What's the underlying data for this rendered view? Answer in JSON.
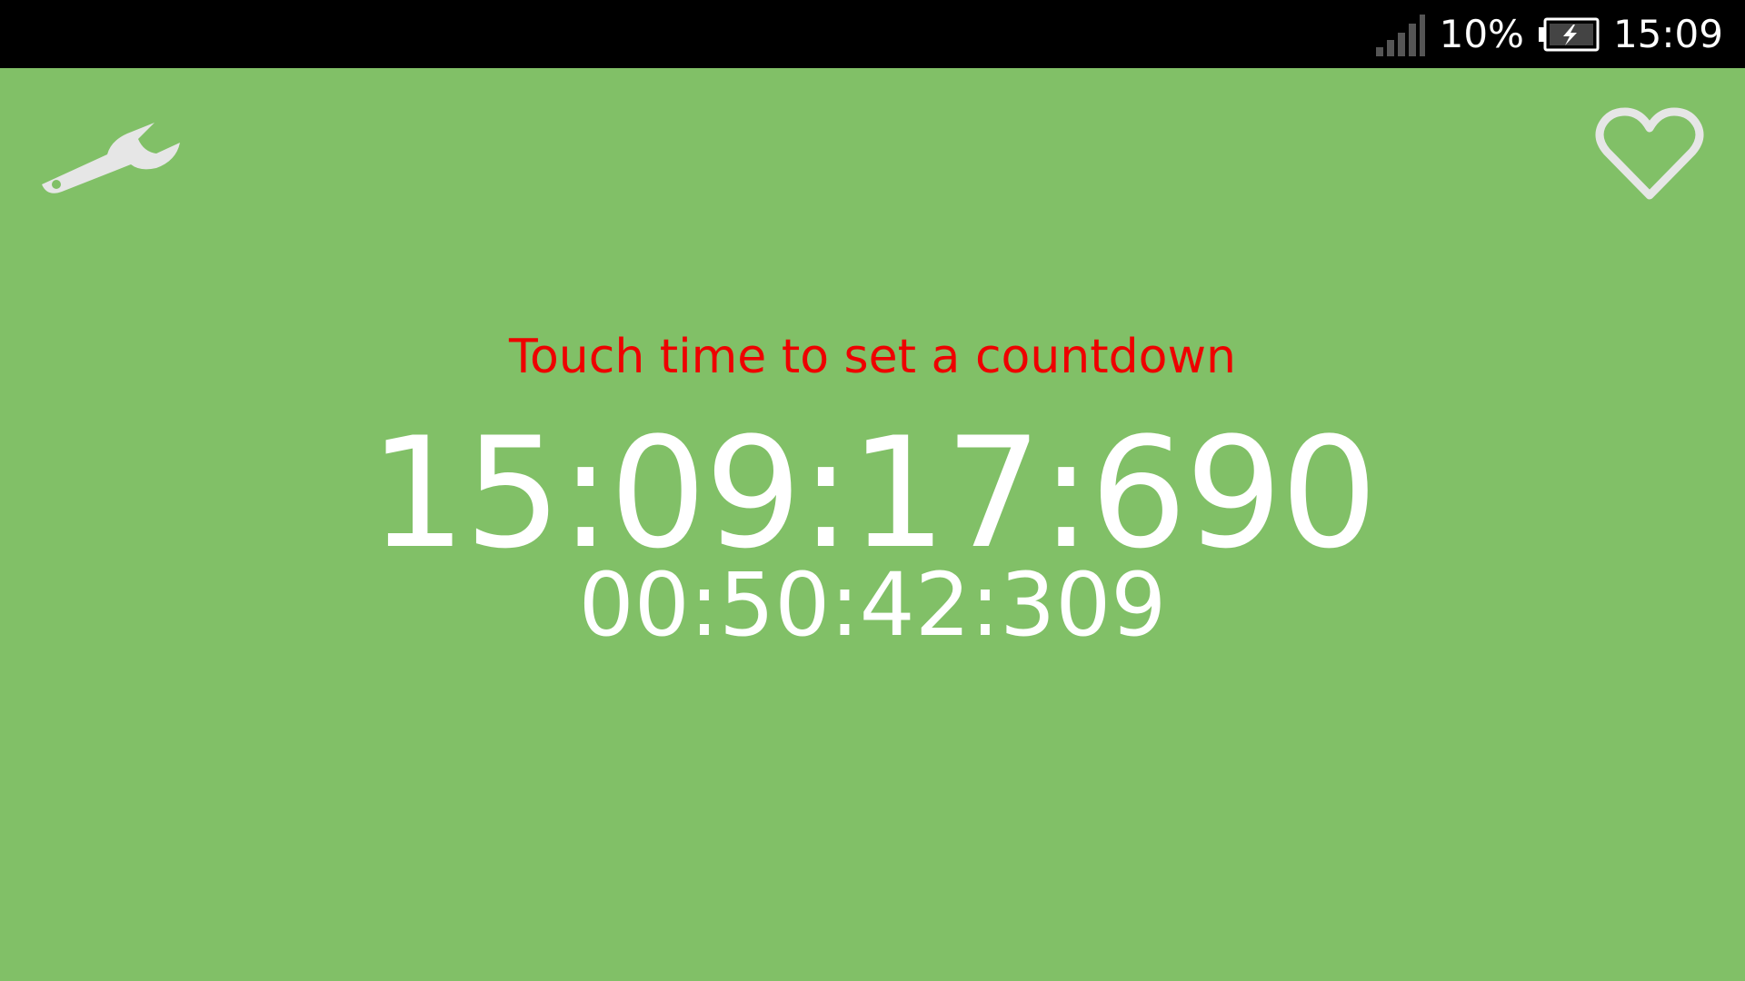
{
  "status_bar": {
    "battery_percent": "10%",
    "clock": "15:09",
    "signal_icon": "signal-strength-icon",
    "battery_icon": "battery-charging-icon"
  },
  "toolbar": {
    "settings_icon": "wrench-icon",
    "favorite_icon": "heart-outline-icon"
  },
  "main": {
    "hint": "Touch time to set a countdown",
    "current_time": "15:09:17:690",
    "countdown": "00:50:42:309"
  },
  "colors": {
    "background": "#81c067",
    "hint_text": "#ee0000",
    "time_text": "#ffffff",
    "icon": "#e6e6e6"
  }
}
